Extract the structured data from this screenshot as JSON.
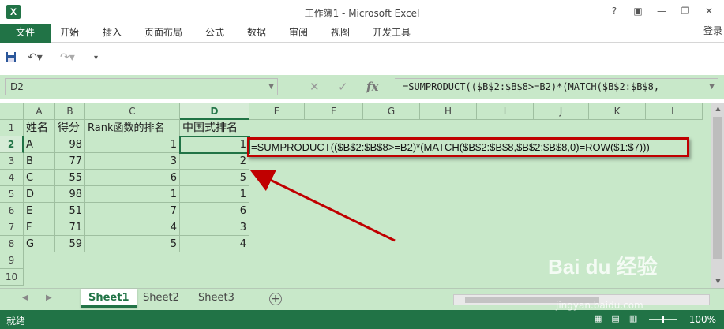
{
  "window": {
    "title": "工作簿1 - Microsoft Excel",
    "app_icon": "excel-logo",
    "buttons": [
      "help-icon",
      "ribbon-display-icon",
      "minimize-icon",
      "restore-icon",
      "close-icon"
    ]
  },
  "ribbon": {
    "tabs": [
      "文件",
      "开始",
      "插入",
      "页面布局",
      "公式",
      "数据",
      "审阅",
      "视图",
      "开发工具"
    ],
    "login": "登录"
  },
  "quick_access": [
    "save-icon",
    "undo-icon",
    "redo-icon",
    "customize-icon"
  ],
  "formula_bar": {
    "name_box": "D2",
    "fx_label": "fx",
    "formula": "=SUMPRODUCT(($B$2:$B$8>=B2)*(MATCH($B$2:$B$8,"
  },
  "sheet": {
    "columns": [
      "A",
      "B",
      "C",
      "D",
      "E",
      "F",
      "G",
      "H",
      "I",
      "J",
      "K",
      "L"
    ],
    "rows": [
      "1",
      "2",
      "3",
      "4",
      "5",
      "6",
      "7",
      "8",
      "9",
      "10"
    ],
    "header_row": [
      "姓名",
      "得分",
      "Rank函数的排名",
      "中国式排名"
    ],
    "data": [
      {
        "name": "A",
        "score": "98",
        "rank": "1",
        "cn_rank": "1"
      },
      {
        "name": "B",
        "score": "77",
        "rank": "3",
        "cn_rank": "2"
      },
      {
        "name": "C",
        "score": "55",
        "rank": "6",
        "cn_rank": "5"
      },
      {
        "name": "D",
        "score": "98",
        "rank": "1",
        "cn_rank": "1"
      },
      {
        "name": "E",
        "score": "51",
        "rank": "7",
        "cn_rank": "6"
      },
      {
        "name": "F",
        "score": "71",
        "rank": "4",
        "cn_rank": "3"
      },
      {
        "name": "G",
        "score": "59",
        "rank": "5",
        "cn_rank": "4"
      }
    ],
    "active_cell": "D2",
    "callout_formula": "=SUMPRODUCT(($B$2:$B$8>=B2)*(MATCH($B$2:$B$8,$B$2:$B$8,0)=ROW($1:$7)))"
  },
  "sheet_tabs": [
    "Sheet1",
    "Sheet2",
    "Sheet3"
  ],
  "active_sheet": "Sheet1",
  "status": {
    "ready": "就绪",
    "zoom": "100%"
  },
  "watermark": {
    "main": "Bai du 经验",
    "sub": "jingyan.baidu.com"
  },
  "colors": {
    "excel_green": "#217346",
    "sheet_bg": "#c8e8c9",
    "callout_red": "#c00000"
  }
}
